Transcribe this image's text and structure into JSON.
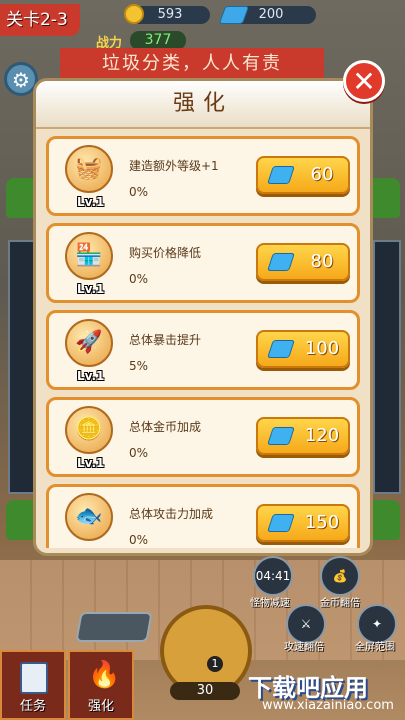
{
  "header": {
    "level": "关卡2-3",
    "coins": "593",
    "gems": "200",
    "power_label": "战力",
    "power_value": "377",
    "banner": "垃圾分类，人人有责"
  },
  "modal": {
    "title": "强化",
    "items": [
      {
        "icon": "bread-basket-icon",
        "level": "Lv.1",
        "name": "建造额外等级+1",
        "percent": "0%",
        "cost": "60"
      },
      {
        "icon": "shop-discount-icon",
        "level": "Lv.1",
        "name": "购买价格降低",
        "percent": "0%",
        "cost": "80"
      },
      {
        "icon": "rocket-crit-icon",
        "level": "Lv.1",
        "name": "总体暴击提升",
        "percent": "5%",
        "cost": "100"
      },
      {
        "icon": "gold-coins-icon",
        "level": "Lv.1",
        "name": "总体金币加成",
        "percent": "0%",
        "cost": "120"
      },
      {
        "icon": "fish-attack-icon",
        "level": "",
        "name": "总体攻击力加成",
        "percent": "0%",
        "cost": "150"
      }
    ]
  },
  "skills": {
    "timer": "04:41",
    "slow_label": "怪物减速",
    "coin_double_label": "金币翻倍",
    "attack_double_label": "攻速翻倍",
    "fullscreen_label": "全屏范围"
  },
  "bottom": {
    "build_cost": "30",
    "badge": "1",
    "tab_task": "任务",
    "tab_upgrade": "强化"
  },
  "watermark": {
    "title": "下载吧应用",
    "url": "www.xiazainiao.com"
  }
}
